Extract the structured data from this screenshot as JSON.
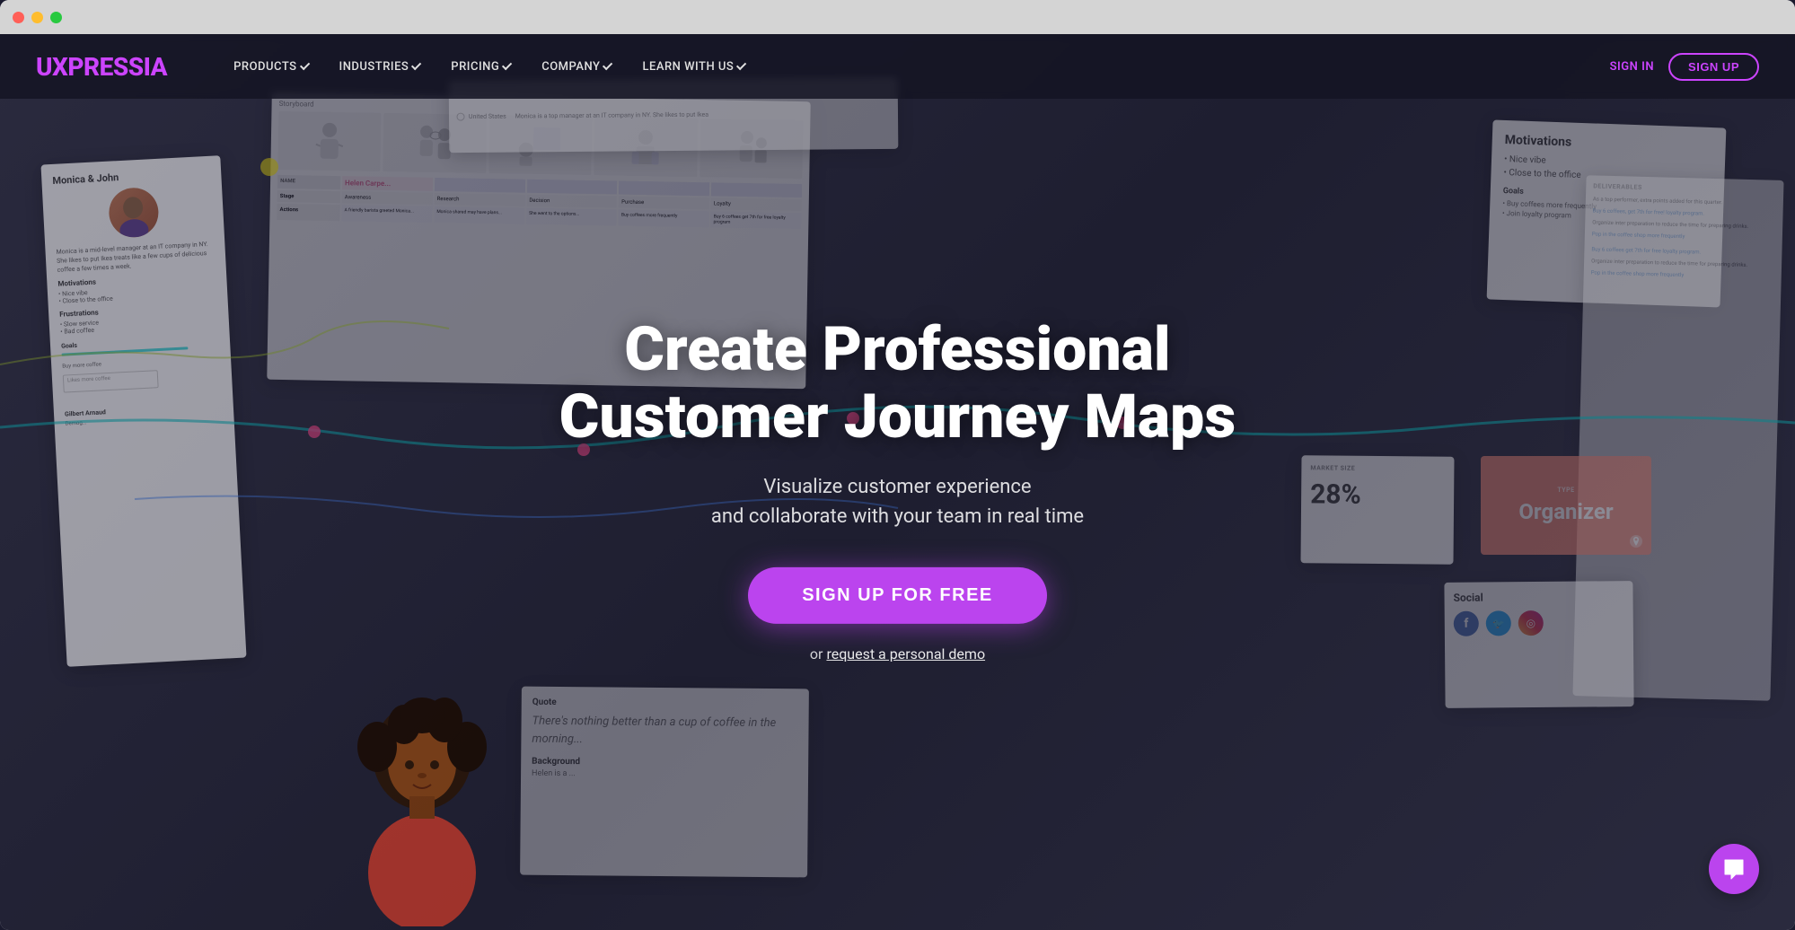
{
  "browser": {
    "traffic_lights": [
      "red",
      "yellow",
      "green"
    ]
  },
  "navbar": {
    "logo": "UXPRESSIA",
    "items": [
      {
        "label": "PRODUCTS",
        "has_dropdown": true
      },
      {
        "label": "INDUSTRIES",
        "has_dropdown": true
      },
      {
        "label": "PRICING",
        "has_dropdown": true
      },
      {
        "label": "COMPANY",
        "has_dropdown": true
      },
      {
        "label": "LEARN WITH US",
        "has_dropdown": true
      }
    ],
    "signin_label": "SIGN IN",
    "signup_label": "SIGN UP"
  },
  "hero": {
    "title_line1": "Create Professional",
    "title_line2": "Customer Journey Maps",
    "subtitle_line1": "Visualize customer experience",
    "subtitle_line2": "and collaborate with your team in real time",
    "cta_label": "SIGN UP FOR FREE",
    "demo_prefix": "or ",
    "demo_link_label": "request a personal demo"
  },
  "background_cards": {
    "persona_name": "Monica & John",
    "persona_role_text": "Monica is a mid-level manager at an IT company in NY. She likes to put Ikea treats like a few cups of delicious coffee a few times a week.",
    "motivations_title": "Motivations",
    "motivations": [
      "Nice vibe",
      "Close to the office"
    ],
    "frustrations_title": "Frustrations",
    "frustrations": [
      "Slow service",
      "Bad coffee"
    ],
    "helen_name": "Helen Carpe...",
    "storyboard_label": "Storyboard",
    "market_size_label": "MARKET SIZE",
    "market_size_value": "28%",
    "organizer_label": "Organizer",
    "social_label": "Social",
    "quote_label": "Quote",
    "quote_text": "There's nothing better than a cup of coffee in the morning...",
    "background_label": "Background",
    "background_text": "Helen is a ...",
    "gilbert_name": "Gilbert Arnaud",
    "demo_label": "Demog...",
    "type_label": "TYPE"
  },
  "chat_widget": {
    "icon": "chat-icon"
  }
}
